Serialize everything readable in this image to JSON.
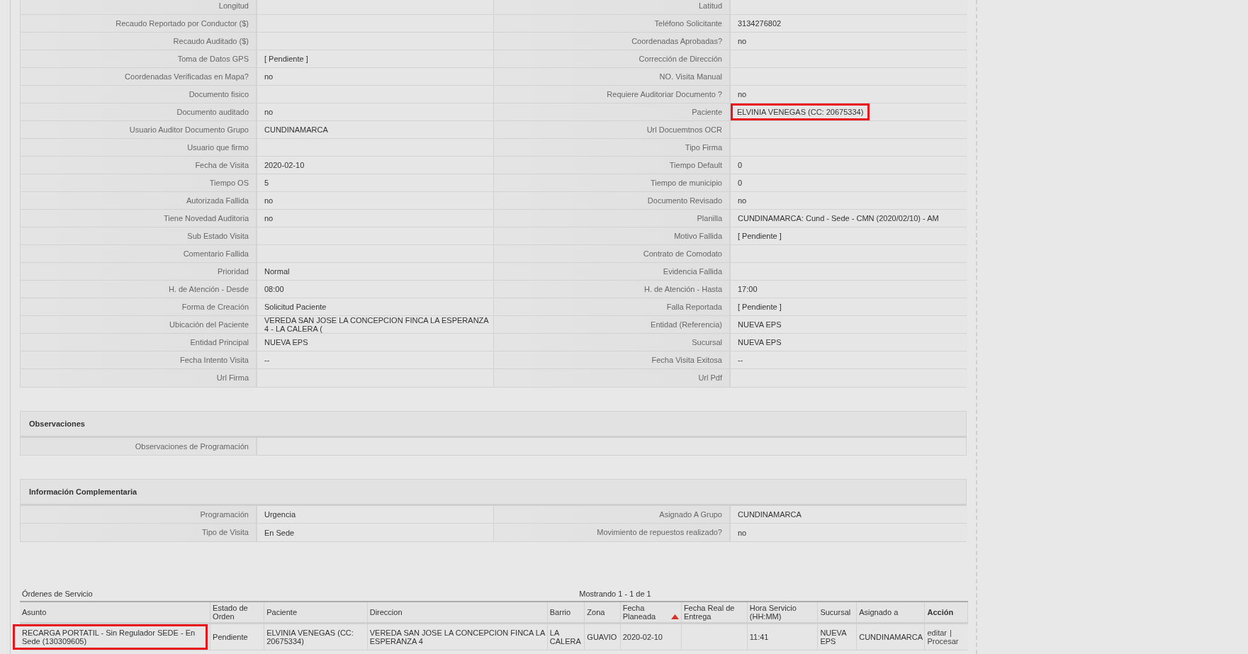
{
  "details": {
    "rows": [
      [
        {
          "label": "Longitud"
        },
        {
          "label": "Latitud"
        }
      ],
      [
        {
          "label": "Recaudo Reportado por Conductor ($)"
        },
        {
          "label": "Teléfono Solicitante",
          "value": "3134276802"
        }
      ],
      [
        {
          "label": "Recaudo Auditado ($)"
        },
        {
          "label": "Coordenadas Aprobadas?",
          "value": "no"
        }
      ],
      [
        {
          "label": "Toma de Datos GPS",
          "value": "[ Pendiente ]"
        },
        {
          "label": "Corrección de Dirección"
        }
      ],
      [
        {
          "label": "Coordenadas Verificadas en Mapa?",
          "value": "no"
        },
        {
          "label": "NO. Visita Manual"
        }
      ],
      [
        {
          "label": "Documento fisico"
        },
        {
          "label": "Requiere Auditoriar Documento ?",
          "value": "no"
        }
      ],
      [
        {
          "label": "Documento auditado",
          "value": "no"
        },
        {
          "label": "Paciente",
          "value": "ELVINIA VENEGAS (CC: 20675334)",
          "highlighted": true
        }
      ],
      [
        {
          "label": "Usuario Auditor Documento Grupo",
          "value": "CUNDINAMARCA"
        },
        {
          "label": "Url Docuemtnos OCR"
        }
      ],
      [
        {
          "label": "Usuario que firmo"
        },
        {
          "label": "Tipo Firma"
        }
      ],
      [
        {
          "label": "Fecha de Visita",
          "value": "2020-02-10"
        },
        {
          "label": "Tiempo Default",
          "value": "0"
        }
      ],
      [
        {
          "label": "Tiempo OS",
          "value": "5"
        },
        {
          "label": "Tiempo de municipio",
          "value": "0"
        }
      ],
      [
        {
          "label": "Autorizada Fallida",
          "value": "no"
        },
        {
          "label": "Documento Revisado",
          "value": "no"
        }
      ],
      [
        {
          "label": "Tiene Novedad Auditoria",
          "value": "no"
        },
        {
          "label": "Planilla",
          "value": "CUNDINAMARCA: Cund - Sede - CMN (2020/02/10) - AM"
        }
      ],
      [
        {
          "label": "Sub Estado Visita"
        },
        {
          "label": "Motivo Fallida",
          "value": "[ Pendiente ]"
        }
      ],
      [
        {
          "label": "Comentario Fallida"
        },
        {
          "label": "Contrato de Comodato"
        }
      ],
      [
        {
          "label": "Prioridad",
          "value": "Normal"
        },
        {
          "label": "Evidencia Fallida"
        }
      ],
      [
        {
          "label": "H. de Atención - Desde",
          "value": "08:00"
        },
        {
          "label": "H. de Atención - Hasta",
          "value": "17:00"
        }
      ],
      [
        {
          "label": "Forma de Creación",
          "value": "Solicitud Paciente"
        },
        {
          "label": "Falla Reportada",
          "value": "[ Pendiente ]"
        }
      ],
      [
        {
          "label": "Ubicación del Paciente",
          "value": "VEREDA SAN JOSE LA CONCEPCION FINCA LA ESPERANZA 4 - LA CALERA ("
        },
        {
          "label": "Entidad (Referencia)",
          "value": "NUEVA EPS"
        }
      ],
      [
        {
          "label": "Entidad Principal",
          "value": "NUEVA EPS"
        },
        {
          "label": "Sucursal",
          "value": "NUEVA EPS"
        }
      ],
      [
        {
          "label": "Fecha Intento Visita",
          "value": "--"
        },
        {
          "label": "Fecha Visita Exitosa",
          "value": "--"
        }
      ],
      [
        {
          "label": "Url Firma"
        },
        {
          "label": "Url Pdf"
        }
      ]
    ]
  },
  "observaciones": {
    "title": "Observaciones",
    "rows": [
      {
        "label": "Observaciones de Programación"
      }
    ]
  },
  "informacion_complementaria": {
    "title": "Información Complementaria",
    "rows": [
      [
        {
          "label": "Programación",
          "value": "Urgencia"
        },
        {
          "label": "Asignado A Grupo",
          "value": "CUNDINAMARCA"
        }
      ],
      [
        {
          "label": "Tipo de Visita",
          "value": "En Sede"
        },
        {
          "label": "Movimiento de repuestos realizado?",
          "value": "no"
        }
      ]
    ]
  },
  "ordenes": {
    "title": "Órdenes de Servicio",
    "pagination": "Mostrando 1 - 1 de 1",
    "columns": [
      {
        "label": "Asunto",
        "sorted": false
      },
      {
        "label": "Estado de Orden",
        "sorted": false
      },
      {
        "label": "Paciente",
        "sorted": false
      },
      {
        "label": "Direccion",
        "sorted": false
      },
      {
        "label": "Barrio",
        "sorted": false
      },
      {
        "label": "Zona",
        "sorted": false
      },
      {
        "label": "Fecha Planeada",
        "sorted": true
      },
      {
        "label": "Fecha Real de Entrega",
        "sorted": false
      },
      {
        "label": "Hora Servicio (HH:MM)",
        "sorted": false
      },
      {
        "label": "Sucursal",
        "sorted": false
      },
      {
        "label": "Asignado a",
        "sorted": false
      },
      {
        "label": "Acción",
        "sorted": false
      }
    ],
    "rows": [
      {
        "cells": [
          {
            "text": "RECARGA PORTATIL - Sin Regulador SEDE - En Sede (130309605)",
            "highlighted": true
          },
          {
            "text": "Pendiente"
          },
          {
            "text": "ELVINIA VENEGAS (CC: 20675334)"
          },
          {
            "text": "VEREDA SAN JOSE LA CONCEPCION FINCA LA ESPERANZA 4"
          },
          {
            "text": "LA CALERA"
          },
          {
            "text": "GUAVIO"
          },
          {
            "text": "2020-02-10"
          },
          {},
          {
            "text": "11:41"
          },
          {
            "text": "NUEVA EPS"
          },
          {
            "text": "CUNDINAMARCA"
          }
        ],
        "actions": [
          "editar",
          "|",
          "Procesar"
        ]
      }
    ]
  }
}
